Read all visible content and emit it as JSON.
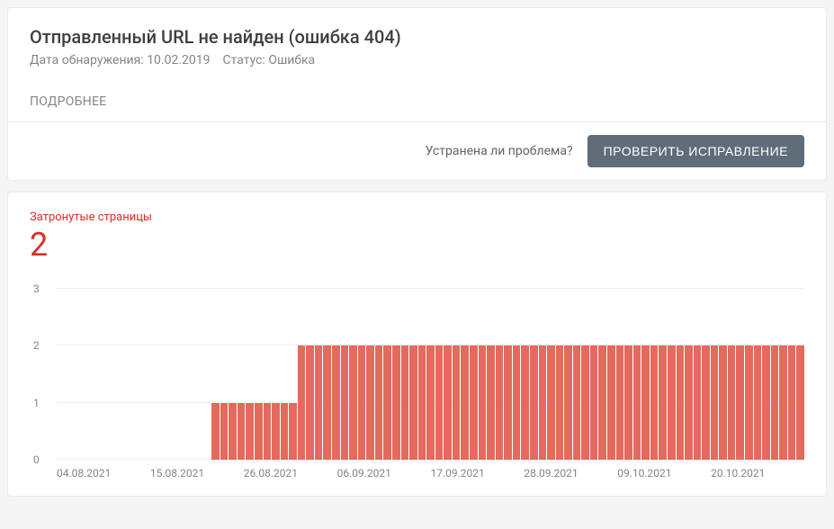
{
  "header": {
    "title": "Отправленный URL не найден (ошибка 404)",
    "detected_label": "Дата обнаружения:",
    "detected_date": "10.02.2019",
    "status_label": "Статус:",
    "status_value": "Ошибка",
    "details_link": "ПОДРОБНЕЕ"
  },
  "footer": {
    "question": "Устранена ли проблема?",
    "button": "ПРОВЕРИТЬ ИСПРАВЛЕНИЕ"
  },
  "summary": {
    "label": "Затронутые страницы",
    "count": "2"
  },
  "chart_data": {
    "type": "bar",
    "title": "Затронутые страницы",
    "xlabel": "",
    "ylabel": "",
    "ylim": [
      0,
      3
    ],
    "yticks": [
      0,
      1,
      2,
      3
    ],
    "xticks": [
      "04.08.2021",
      "15.08.2021",
      "26.08.2021",
      "06.09.2021",
      "17.09.2021",
      "28.09.2021",
      "09.10.2021",
      "20.10.2021"
    ],
    "categories": [
      "04.08.2021",
      "05.08.2021",
      "06.08.2021",
      "07.08.2021",
      "08.08.2021",
      "09.08.2021",
      "10.08.2021",
      "11.08.2021",
      "12.08.2021",
      "13.08.2021",
      "14.08.2021",
      "15.08.2021",
      "16.08.2021",
      "17.08.2021",
      "18.08.2021",
      "19.08.2021",
      "20.08.2021",
      "21.08.2021",
      "22.08.2021",
      "23.08.2021",
      "24.08.2021",
      "25.08.2021",
      "26.08.2021",
      "27.08.2021",
      "28.08.2021",
      "29.08.2021",
      "30.08.2021",
      "31.08.2021",
      "01.09.2021",
      "02.09.2021",
      "03.09.2021",
      "04.09.2021",
      "05.09.2021",
      "06.09.2021",
      "07.09.2021",
      "08.09.2021",
      "09.09.2021",
      "10.09.2021",
      "11.09.2021",
      "12.09.2021",
      "13.09.2021",
      "14.09.2021",
      "15.09.2021",
      "16.09.2021",
      "17.09.2021",
      "18.09.2021",
      "19.09.2021",
      "20.09.2021",
      "21.09.2021",
      "22.09.2021",
      "23.09.2021",
      "24.09.2021",
      "25.09.2021",
      "26.09.2021",
      "27.09.2021",
      "28.09.2021",
      "29.09.2021",
      "30.09.2021",
      "01.10.2021",
      "02.10.2021",
      "03.10.2021",
      "04.10.2021",
      "05.10.2021",
      "06.10.2021",
      "07.10.2021",
      "08.10.2021",
      "09.10.2021",
      "10.10.2021",
      "11.10.2021",
      "12.10.2021",
      "13.10.2021",
      "14.10.2021",
      "15.10.2021",
      "16.10.2021",
      "17.10.2021",
      "18.10.2021",
      "19.10.2021",
      "20.10.2021",
      "21.10.2021",
      "22.10.2021",
      "23.10.2021",
      "24.10.2021",
      "25.10.2021",
      "26.10.2021",
      "27.10.2021",
      "28.10.2021",
      "29.10.2021"
    ],
    "values": [
      0,
      0,
      0,
      0,
      0,
      0,
      0,
      0,
      0,
      0,
      0,
      0,
      0,
      0,
      0,
      0,
      0,
      0,
      1,
      1,
      1,
      1,
      1,
      1,
      1,
      1,
      1,
      1,
      2,
      2,
      2,
      2,
      2,
      2,
      2,
      2,
      2,
      2,
      2,
      2,
      2,
      2,
      2,
      2,
      2,
      2,
      2,
      2,
      2,
      2,
      2,
      2,
      2,
      2,
      2,
      2,
      2,
      2,
      2,
      2,
      2,
      2,
      2,
      2,
      2,
      2,
      2,
      2,
      2,
      2,
      2,
      2,
      2,
      2,
      2,
      2,
      2,
      2,
      2,
      2,
      2,
      2,
      2,
      2,
      2,
      2,
      2
    ]
  }
}
